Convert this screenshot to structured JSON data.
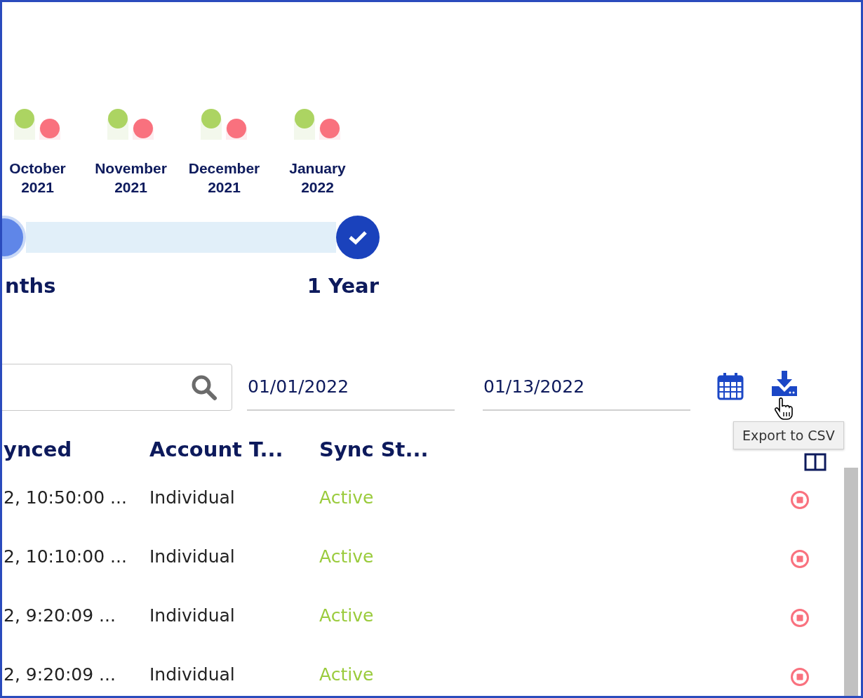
{
  "months": [
    {
      "label": "October\n2021"
    },
    {
      "label": "November\n2021"
    },
    {
      "label": "December\n2021"
    },
    {
      "label": "January\n2022"
    }
  ],
  "range_slider": {
    "options": [
      {
        "label": "nths",
        "selected": false
      },
      {
        "label": "1 Year",
        "selected": true
      }
    ]
  },
  "filters": {
    "start_date": "01/01/2022",
    "end_date": "01/13/2022",
    "export_tooltip": "Export to CSV"
  },
  "table": {
    "columns": [
      "ynced",
      "Account T...",
      "Sync St..."
    ],
    "rows": [
      {
        "last_synced": "2, 10:50:00 ...",
        "account_type": "Individual",
        "sync_status": "Active"
      },
      {
        "last_synced": "2, 10:10:00 ...",
        "account_type": "Individual",
        "sync_status": "Active"
      },
      {
        "last_synced": "2, 9:20:09 ...",
        "account_type": "Individual",
        "sync_status": "Active"
      },
      {
        "last_synced": "2, 9:20:09 ...",
        "account_type": "Individual",
        "sync_status": "Active"
      }
    ]
  }
}
